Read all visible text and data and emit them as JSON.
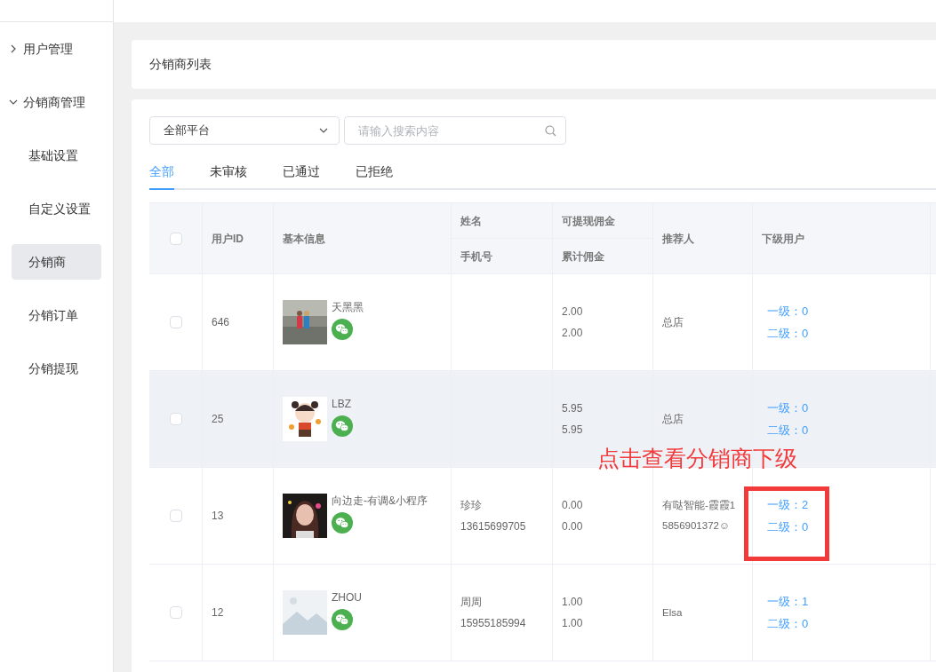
{
  "sidebar": {
    "items": [
      {
        "label": "用户管理",
        "expanded": false
      },
      {
        "label": "分销商管理",
        "expanded": true,
        "children": [
          {
            "label": "基础设置",
            "selected": false
          },
          {
            "label": "自定义设置",
            "selected": false
          },
          {
            "label": "分销商",
            "selected": true
          },
          {
            "label": "分销订单",
            "selected": false
          },
          {
            "label": "分销提现",
            "selected": false
          }
        ]
      }
    ]
  },
  "page_title": "分销商列表",
  "filters": {
    "platform": "全部平台",
    "search": {
      "placeholder": "请输入搜索内容"
    }
  },
  "tabs": [
    {
      "label": "全部",
      "selected": true
    },
    {
      "label": "未审核",
      "selected": false
    },
    {
      "label": "已通过",
      "selected": false
    },
    {
      "label": "已拒绝",
      "selected": false
    }
  ],
  "table": {
    "select_all": {
      "checked": false
    },
    "columns": [
      {
        "label": "用户ID"
      },
      {
        "label": "基本信息"
      },
      {
        "label": "姓名",
        "sub_label": "手机号"
      },
      {
        "label": "可提现佣金",
        "sub_label": "累计佣金"
      },
      {
        "label": "推荐人"
      },
      {
        "label": "下级用户"
      }
    ],
    "rows": [
      {
        "checked": false,
        "highlighted": false,
        "id": "646",
        "nickname": "天黑黑",
        "withdrawable": "2.00",
        "total": "2.00",
        "referrer": "总店",
        "level1": "一级：0",
        "level2": "二级：0"
      },
      {
        "checked": false,
        "highlighted": true,
        "id": "25",
        "nickname": "LBZ",
        "withdrawable": "5.95",
        "total": "5.95",
        "referrer": "总店",
        "level1": "一级：0",
        "level2": "二级：0"
      },
      {
        "checked": false,
        "highlighted": false,
        "id": "13",
        "nickname": "向边走-有调&小程序",
        "name": "珍珍",
        "phone": "13615699705",
        "withdrawable": "0.00",
        "total": "0.00",
        "referrer": "有哒智能-霞霞15856901372☺",
        "level1": "一级：2",
        "level2": "二级：0"
      },
      {
        "checked": false,
        "highlighted": false,
        "id": "12",
        "nickname": "ZHOU",
        "name": "周周",
        "phone": "15955185994",
        "withdrawable": "1.00",
        "total": "1.00",
        "referrer": "Elsa",
        "level1": "一级：1",
        "level2": "二级：0"
      }
    ]
  },
  "annotation": {
    "text": "点击查看分销商下级"
  }
}
